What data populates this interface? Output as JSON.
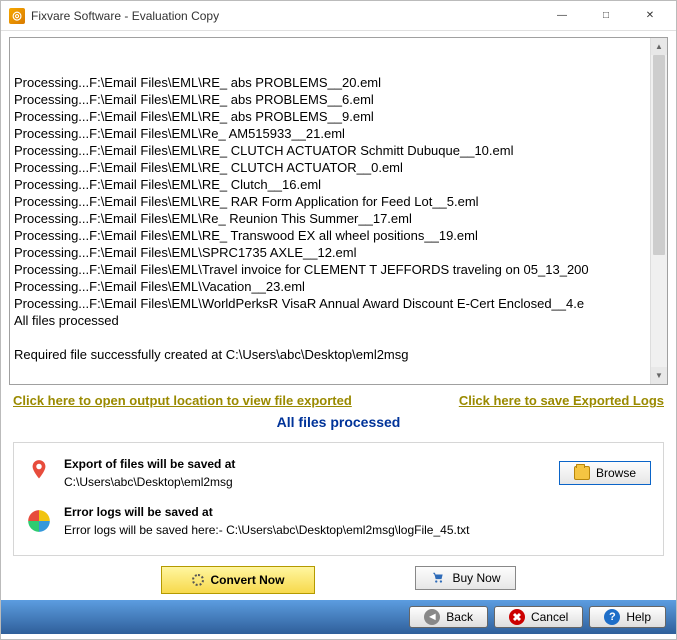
{
  "window": {
    "title": "Fixvare Software - Evaluation Copy"
  },
  "log_lines": [
    "Processing...F:\\Email Files\\EML\\RE_ abs PROBLEMS__20.eml",
    "Processing...F:\\Email Files\\EML\\RE_ abs PROBLEMS__6.eml",
    "Processing...F:\\Email Files\\EML\\RE_ abs PROBLEMS__9.eml",
    "Processing...F:\\Email Files\\EML\\Re_ AM515933__21.eml",
    "Processing...F:\\Email Files\\EML\\RE_ CLUTCH ACTUATOR Schmitt Dubuque__10.eml",
    "Processing...F:\\Email Files\\EML\\RE_ CLUTCH ACTUATOR__0.eml",
    "Processing...F:\\Email Files\\EML\\RE_ Clutch__16.eml",
    "Processing...F:\\Email Files\\EML\\RE_ RAR Form Application for Feed Lot__5.eml",
    "Processing...F:\\Email Files\\EML\\Re_ Reunion This Summer__17.eml",
    "Processing...F:\\Email Files\\EML\\RE_ Transwood EX all wheel positions__19.eml",
    "Processing...F:\\Email Files\\EML\\SPRC1735 AXLE__12.eml",
    "Processing...F:\\Email Files\\EML\\Travel invoice for CLEMENT T JEFFORDS traveling on 05_13_200",
    "Processing...F:\\Email Files\\EML\\Vacation__23.eml",
    "Processing...F:\\Email Files\\EML\\WorldPerksR VisaR Annual Award Discount E-Cert Enclosed__4.e",
    "All files processed",
    "",
    "Required file successfully created at C:\\Users\\abc\\Desktop\\eml2msg"
  ],
  "links": {
    "open_output": "Click here to open output location to view file exported",
    "save_logs": "Click here to save Exported Logs"
  },
  "status": "All files processed",
  "export": {
    "label": "Export of files will be saved at",
    "path": "C:\\Users\\abc\\Desktop\\eml2msg",
    "browse": "Browse"
  },
  "errorlog": {
    "label": "Error logs will be saved at",
    "path": "Error logs will be saved here:- C:\\Users\\abc\\Desktop\\eml2msg\\logFile_45.txt"
  },
  "actions": {
    "convert": "Convert Now",
    "buy": "Buy Now"
  },
  "footer": {
    "back": "Back",
    "cancel": "Cancel",
    "help": "Help"
  }
}
